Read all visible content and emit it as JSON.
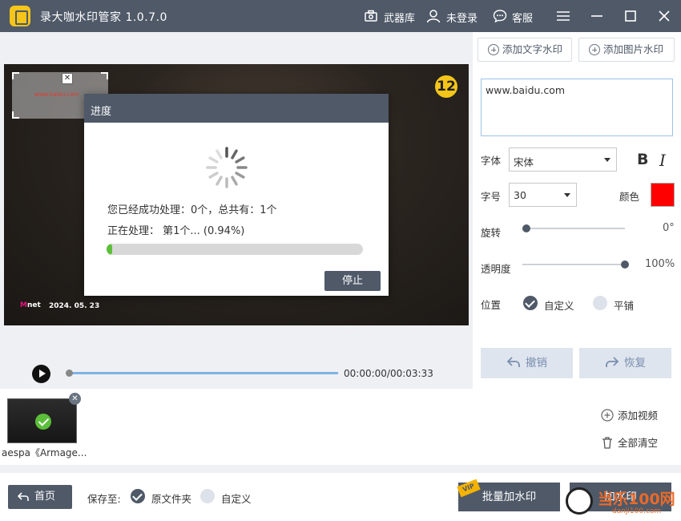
{
  "app": {
    "title": "录大咖水印管家  1.0.7.0"
  },
  "titlebar": {
    "arsenal": "武器库",
    "login": "未登录",
    "service": "客服"
  },
  "preview": {
    "watermark_text": "www.baidu.com",
    "badge": "12",
    "channel": "net",
    "date": "2024. 05. 23"
  },
  "dialog": {
    "title": "进度",
    "processed_line": "您已经成功处理：0个，总共有：1个",
    "current_line": "正在处理：    第1个... (0.94%)",
    "progress": 0.0094,
    "stop_label": "停止"
  },
  "player": {
    "time": "00:00:00/00:03:33",
    "position": 0
  },
  "panel": {
    "add_text_watermark": "添加文字水印",
    "add_image_watermark": "添加图片水印",
    "watermark_text": "www.baidu.com",
    "font_label": "字体",
    "font_value": "宋体",
    "bold": "B",
    "italic": "I",
    "size_label": "字号",
    "size_value": "30",
    "color_label": "颜色",
    "color_value": "#ff0000",
    "rotate_label": "旋转",
    "rotate_value": "0°",
    "rotate_fraction": 0,
    "opacity_label": "透明度",
    "opacity_value": "100%",
    "opacity_fraction": 1,
    "position_label": "位置",
    "position_custom": "自定义",
    "position_tile": "平铺",
    "undo": "撤销",
    "redo": "恢复"
  },
  "files": {
    "items": [
      {
        "name": "aespa《Armage..."
      }
    ],
    "add_video": "添加视频",
    "clear_all": "全部清空"
  },
  "bottom": {
    "home": "首页",
    "save_to": "保存至:",
    "save_original": "原文件夹",
    "save_custom": "自定义",
    "vip": "VIP",
    "batch_add": "批量加水印",
    "add": "加水印"
  },
  "site_watermark": {
    "text": "当乐100网",
    "url": "danji100.com"
  },
  "colors": {
    "header": "#4f5968",
    "accent": "#f5c518",
    "progress": "#5bbf3a",
    "swatch": "#ff0000"
  }
}
